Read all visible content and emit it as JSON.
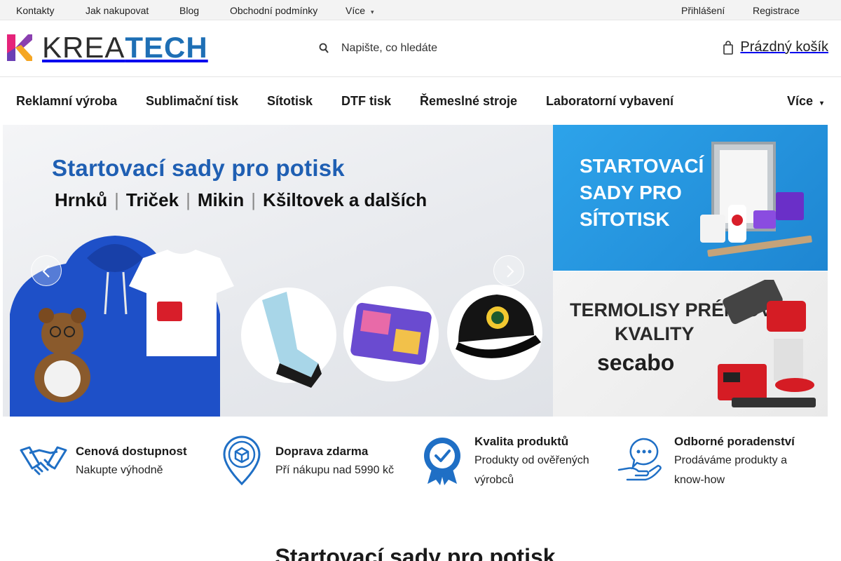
{
  "topbar": {
    "links": [
      "Kontakty",
      "Jak nakupovat",
      "Blog",
      "Obchodní podmínky"
    ],
    "more_label": "Více",
    "login_label": "Přihlášení",
    "register_label": "Registrace"
  },
  "header": {
    "logo_part1": "KREA",
    "logo_part2": "TECH",
    "search_placeholder": "Napište, co hledáte",
    "cart_label": "Prázdný košík"
  },
  "nav": {
    "items": [
      "Reklamní výroba",
      "Sublimační tisk",
      "Sítotisk",
      "DTF tisk",
      "Řemeslné stroje",
      "Laboratorní vybavení"
    ],
    "more_label": "Více"
  },
  "hero": {
    "title": "Startovací sady pro potisk",
    "sub": [
      "Hrnků",
      "Triček",
      "Mikin",
      "Kšiltovek a dalších"
    ]
  },
  "side_banner_1": {
    "line1": "STARTOVACÍ",
    "line2": "SADY PRO",
    "line3": "SÍTOTISK"
  },
  "side_banner_2": {
    "line1": "TERMOLISY PRÉMIOVÉ",
    "line2": "KVALITY",
    "brand": "secabo"
  },
  "features": [
    {
      "title": "Cenová dostupnost",
      "desc": "Nakupte výhodně",
      "icon": "handshake-icon"
    },
    {
      "title": "Doprava zdarma",
      "desc": "Pří nákupu nad 5990 kč",
      "icon": "delivery-pin-icon"
    },
    {
      "title": "Kvalita produktů",
      "desc": "Produkty od ověřených výrobců",
      "icon": "quality-badge-icon"
    },
    {
      "title": "Odborné poradenství",
      "desc": "Prodáváme produkty a know-how",
      "icon": "advice-icon"
    }
  ],
  "section": {
    "title": "Startovací sady pro potisk"
  },
  "colors": {
    "brand_blue": "#1e6fb5",
    "icon_blue": "#1f6fc5",
    "sitotisk_banner": "#2596e0"
  }
}
